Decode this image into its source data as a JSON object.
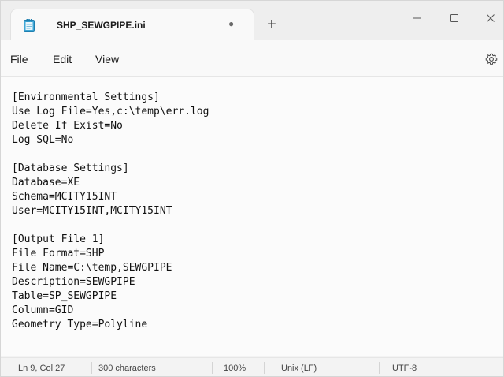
{
  "tab": {
    "title": "SHP_SEWGPIPE.ini",
    "unsaved_indicator": "●",
    "new_tab_label": "+"
  },
  "menu": {
    "file": "File",
    "edit": "Edit",
    "view": "View"
  },
  "editor": {
    "lines": [
      "[Environmental Settings]",
      "Use Log File=Yes,c:\\temp\\err.log",
      "Delete If Exist=No",
      "Log SQL=No",
      "",
      "[Database Settings]",
      "Database=XE",
      "Schema=MCITY15INT",
      "User=MCITY15INT,MCITY15INT",
      "",
      "[Output File 1]",
      "File Format=SHP",
      "File Name=C:\\temp,SEWGPIPE",
      "Description=SEWGPIPE",
      "Table=SP_SEWGPIPE",
      "Column=GID",
      "Geometry Type=Polyline"
    ]
  },
  "status": {
    "position": "Ln 9, Col 27",
    "characters": "300 characters",
    "zoom": "100%",
    "line_ending": "Unix (LF)",
    "encoding": "UTF-8"
  },
  "icons": {
    "app": "notepad-icon",
    "minimize": "minimize-icon",
    "maximize": "maximize-icon",
    "close": "close-icon",
    "settings": "gear-icon"
  }
}
